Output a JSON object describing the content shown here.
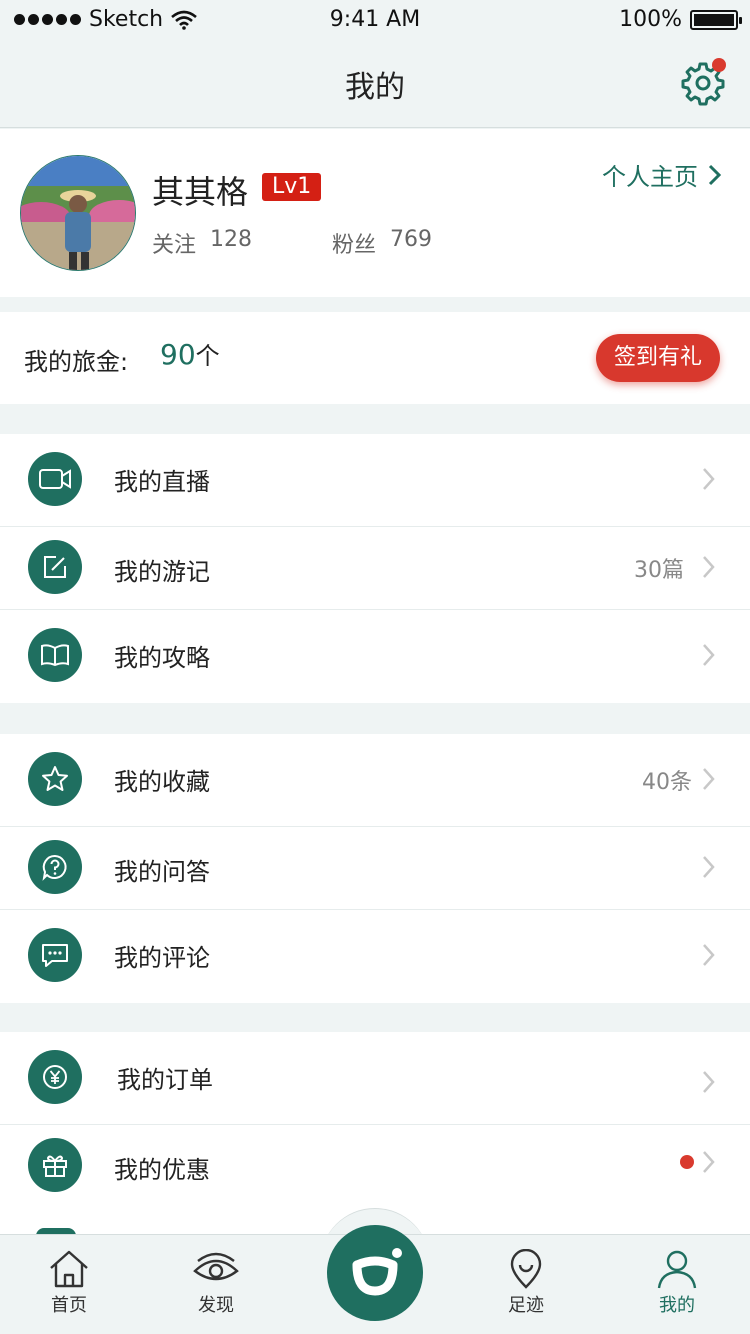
{
  "status_bar": {
    "carrier": "Sketch",
    "time": "9:41 AM",
    "battery": "100%"
  },
  "nav": {
    "title": "我的"
  },
  "profile": {
    "name": "其其格",
    "level": "Lv1",
    "following_label": "关注",
    "following_count": "128",
    "fans_label": "粉丝",
    "fans_count": "769",
    "homepage_label": "个人主页"
  },
  "coins": {
    "label": "我的旅金:",
    "value": "90",
    "unit": "个",
    "signin_label": "签到有礼"
  },
  "menu_groups": [
    {
      "items": [
        {
          "label": "我的直播",
          "extra": "",
          "icon": "video-camera-icon"
        },
        {
          "label": "我的游记",
          "extra": "30篇",
          "icon": "edit-note-icon"
        },
        {
          "label": "我的攻略",
          "extra": "",
          "icon": "open-book-icon"
        }
      ]
    },
    {
      "items": [
        {
          "label": "我的收藏",
          "extra": "40条",
          "icon": "star-icon"
        },
        {
          "label": "我的问答",
          "extra": "",
          "icon": "question-bubble-icon"
        },
        {
          "label": "我的评论",
          "extra": "",
          "icon": "comment-bubble-icon"
        }
      ]
    },
    {
      "items": [
        {
          "label": "我的订单",
          "extra": "",
          "icon": "yen-coin-icon"
        },
        {
          "label": "我的优惠",
          "extra": "",
          "icon": "gift-icon",
          "badge_dot": true
        }
      ]
    }
  ],
  "tabbar": {
    "home": "首页",
    "discover": "发现",
    "footprint": "足迹",
    "mine": "我的"
  },
  "colors": {
    "accent": "#1f6f60",
    "badge": "#d42014",
    "signin": "#d8382d",
    "background": "#eff4f4"
  }
}
